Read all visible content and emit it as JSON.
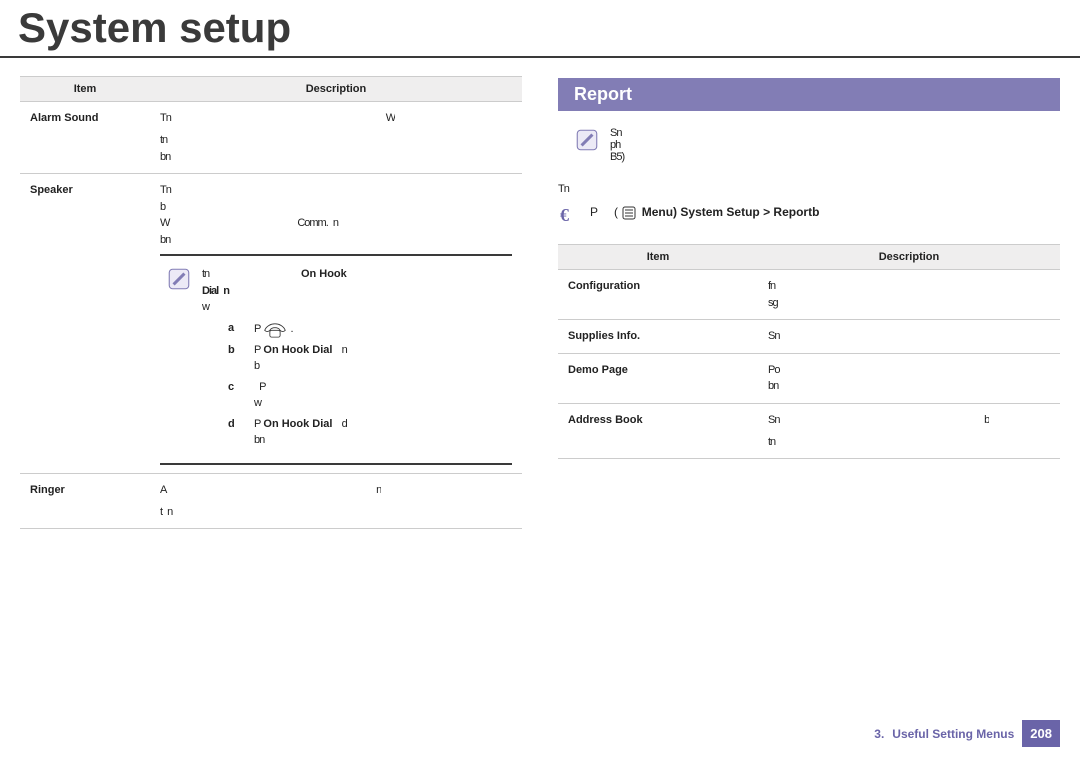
{
  "page": {
    "title": "System setup"
  },
  "left_table": {
    "headers": {
      "item": "Item",
      "desc": "Description"
    },
    "rows": [
      {
        "item": "Alarm Sound",
        "desc_lines": [
          "Tn                                          W",
          "tn",
          "bn"
        ]
      },
      {
        "item": "Speaker",
        "desc_lines": [
          "Tn",
          "b",
          "W                         Comm. n",
          "bn"
        ],
        "note": {
          "intro": "tn",
          "on_hook": "On Hook",
          "dial_label": "Dial n",
          "w": "w",
          "steps": [
            {
              "letter": "a",
              "prefix": "P",
              "text_after_icon": "."
            },
            {
              "letter": "b",
              "prefix": "P",
              "bold": "On Hook Dial ",
              "trail": "n\nb"
            },
            {
              "letter": "c",
              "prefix": "",
              "text": " P\nw"
            },
            {
              "letter": "d",
              "prefix": "P",
              "bold": "On Hook Dial ",
              "trail": "d\nbn"
            }
          ]
        }
      },
      {
        "item": "Ringer",
        "desc_lines": [
          "A                                         n",
          "t n"
        ]
      }
    ]
  },
  "right": {
    "section_title": "Report",
    "note_lines": [
      "Sn",
      "ph",
      "B5)"
    ],
    "intro": "Tn",
    "step1": {
      "prefix": "P   (",
      "menu_label": "Menu)",
      "trail_bold": " System Setup > Reportb",
      "trail": ""
    },
    "table": {
      "headers": {
        "item": "Item",
        "desc": "Description"
      },
      "rows": [
        {
          "item": "Configuration",
          "desc_lines": [
            "fn",
            "sg"
          ]
        },
        {
          "item": "Supplies Info.",
          "desc_lines": [
            "Sn"
          ]
        },
        {
          "item": "Demo Page",
          "desc_lines": [
            "Po",
            "bn"
          ]
        },
        {
          "item": "Address Book",
          "desc_lines": [
            "Sn                                        b",
            "tn"
          ]
        }
      ]
    }
  },
  "footer": {
    "section": "3.",
    "label": "Useful Setting Menus",
    "page": "208"
  }
}
